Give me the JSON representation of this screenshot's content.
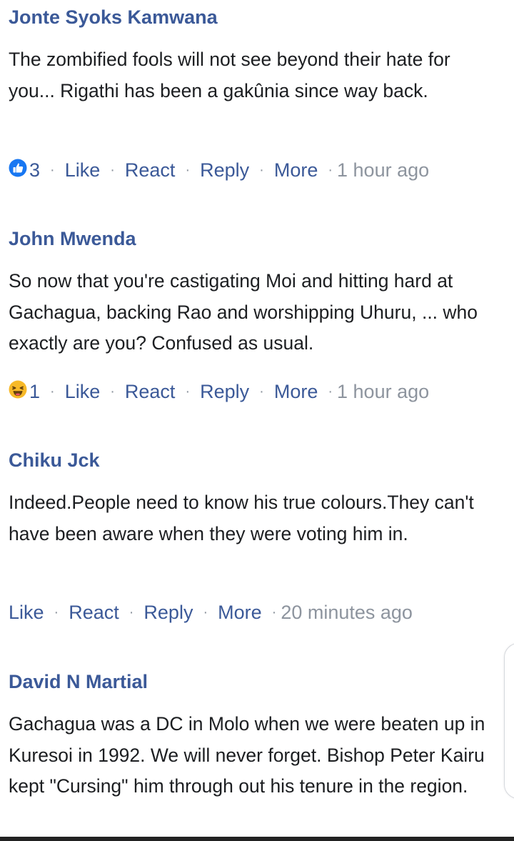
{
  "comments": [
    {
      "author": "Jonte Syoks Kamwana",
      "text": "The zombified fools will not see beyond their hate for you...  Rigathi has been a gakûnia since way back.",
      "reaction_icon": "like-icon",
      "reaction_count": "3",
      "actions": {
        "like": "Like",
        "react": "React",
        "reply": "Reply",
        "more": "More"
      },
      "timestamp": "1 hour ago"
    },
    {
      "author": "John Mwenda",
      "text": "So now that you're castigating Moi and hitting hard at Gachagua, backing Rao and worshipping Uhuru, ... who exactly are you? Confused as usual.",
      "reaction_icon": "haha-icon",
      "reaction_count": "1",
      "actions": {
        "like": "Like",
        "react": "React",
        "reply": "Reply",
        "more": "More"
      },
      "timestamp": "1 hour ago"
    },
    {
      "author": "Chiku Jck",
      "text": "Indeed.People need to know his true colours.They can't have been aware when they were voting him in.",
      "actions": {
        "like": "Like",
        "react": "React",
        "reply": "Reply",
        "more": "More"
      },
      "timestamp": "20 minutes ago"
    },
    {
      "author": "David N Martial",
      "text": "Gachagua was a DC in Molo when we were beaten up in Kuresoi in 1992. We will never forget. Bishop Peter Kairu kept \"Cursing\" him through out his tenure in the region."
    }
  ],
  "separator": "·",
  "colors": {
    "link": "#3b5998",
    "text": "#1c1e21",
    "muted": "#8d949e",
    "like_blue": "#1877f2",
    "haha_yellow": "#f7b928"
  }
}
